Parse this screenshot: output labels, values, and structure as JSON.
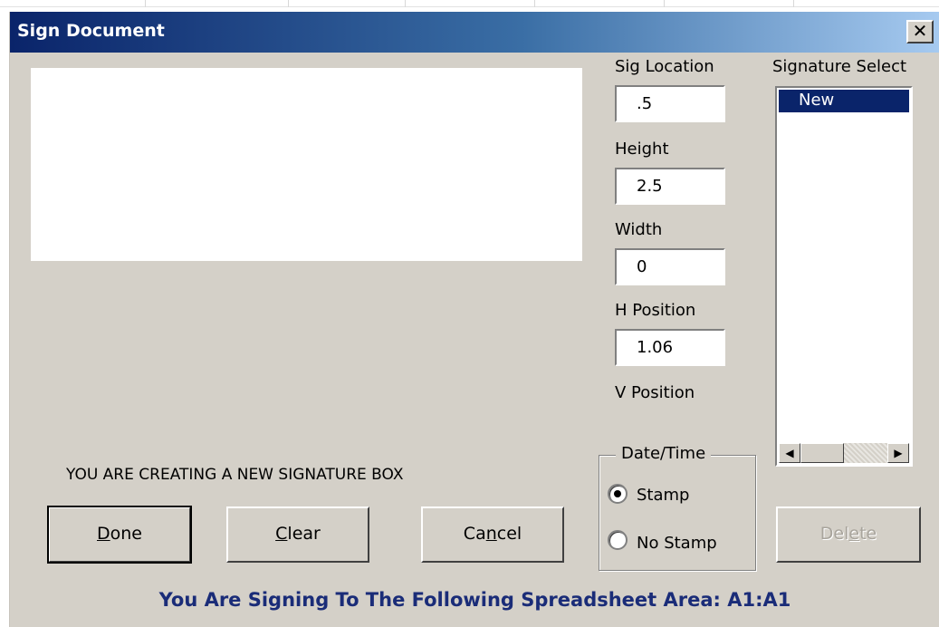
{
  "window": {
    "title": "Sign Document",
    "close_glyph": "✕"
  },
  "fields": {
    "sig_location": {
      "label": "Sig Location",
      "value": ".5"
    },
    "height": {
      "label": "Height",
      "value": "2.5"
    },
    "width": {
      "label": "Width",
      "value": "0"
    },
    "h_position": {
      "label": "H Position",
      "value": "1.06"
    },
    "v_position": {
      "label": "V Position"
    }
  },
  "signature_select": {
    "label": "Signature Select",
    "items": [
      "New"
    ],
    "selected": "New"
  },
  "status_message": "YOU ARE CREATING A NEW SIGNATURE BOX",
  "buttons": {
    "done": {
      "label": "Done",
      "mnemonic": "D",
      "rest": "one"
    },
    "clear": {
      "label": "Clear",
      "mnemonic": "C",
      "rest": "lear"
    },
    "cancel": {
      "label": "Cancel",
      "pre": "Ca",
      "mnemonic": "n",
      "rest": "cel"
    },
    "delete": {
      "label": "Delete",
      "pre": "Del",
      "mnemonic": "e",
      "rest": "te",
      "disabled": true
    }
  },
  "date_time": {
    "caption": "Date/Time",
    "options": [
      {
        "label": "Stamp",
        "selected": true
      },
      {
        "label": "No Stamp",
        "selected": false
      }
    ]
  },
  "footer": "You Are Signing To The Following Spreadsheet Area: A1:A1",
  "colors": {
    "title_gradient_start": "#0a246a",
    "title_gradient_end": "#a6caf0",
    "dialog_face": "#d4d0c8",
    "selection": "#0a246a",
    "footer_text": "#1a2c78"
  }
}
